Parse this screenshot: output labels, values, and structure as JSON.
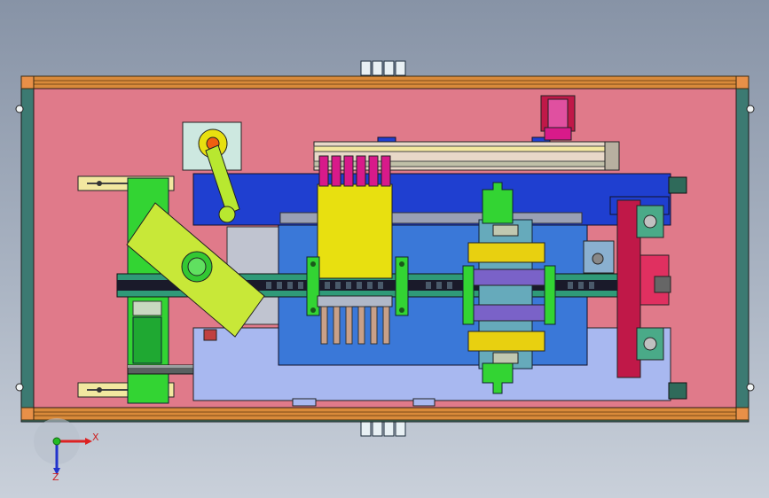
{
  "viewport": {
    "background_top": "#8793a6",
    "background_bottom": "#c9d0da"
  },
  "model": {
    "colors": {
      "frame_rail": "#d98a3a",
      "base_plate": "#e07a8a",
      "side_rail": "#3c7a72",
      "blue_plate": "#1f3fd0",
      "light_blue_plate": "#a8b8f0",
      "mid_blue_plate": "#3a78d8",
      "yellow_block": "#e8e010",
      "lime_arm": "#b8e830",
      "green_part": "#33d433",
      "dark_green_strip": "#2f9a78",
      "magenta_part": "#d81a8a",
      "crimson_part": "#c01848",
      "orange_pin": "#f06010",
      "gray_steel": "#8a8f96"
    }
  },
  "triad": {
    "x_label": "X",
    "z_label": "Z",
    "x_color": "#dd2222",
    "y_color": "#22bb22",
    "z_color": "#2233cc"
  }
}
